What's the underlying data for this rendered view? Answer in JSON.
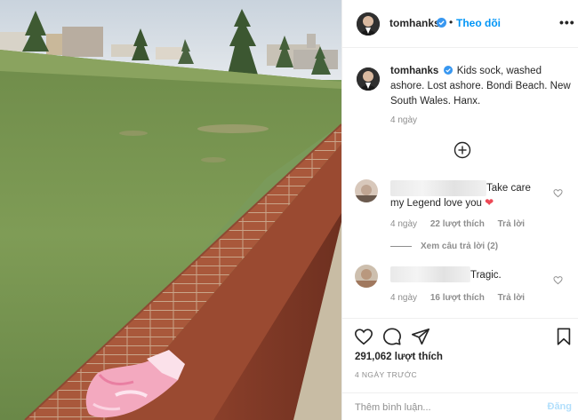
{
  "post": {
    "author": "tomhanks",
    "follow_label": "Theo dõi",
    "separator": "•",
    "more_label": "•••",
    "caption": "Kids sock, washed ashore. Lost ashore. Bondi Beach. New South Wales. Hanx.",
    "caption_age": "4 ngày",
    "likes": "291,062 lượt thích",
    "posted": "4 NGÀY TRƯỚC"
  },
  "comments": [
    {
      "text": "Take care my Legend love you",
      "emoji": "❤",
      "age": "4 ngày",
      "likes": "22 lượt thích",
      "reply_label": "Trả lời",
      "view_replies": "Xem câu trả lời (2)"
    },
    {
      "text": "Tragic.",
      "age": "4 ngày",
      "likes": "16 lượt thích",
      "reply_label": "Trả lời"
    }
  ],
  "comment_box": {
    "placeholder": "Thêm bình luận...",
    "post_label": "Đăng"
  },
  "icons": {
    "verified": "verified-badge-icon",
    "more": "more-options-icon",
    "load_more": "plus-circle-icon",
    "like": "heart-icon",
    "comment": "comment-bubble-icon",
    "share": "paper-plane-icon",
    "save": "bookmark-icon"
  },
  "colors": {
    "accent": "#0095f6",
    "verified": "#3897f0",
    "heart": "#ed4956",
    "muted": "#8e8e8e",
    "post_disabled": "#b2dffc"
  }
}
